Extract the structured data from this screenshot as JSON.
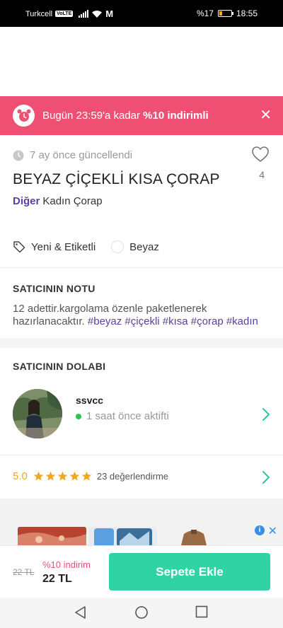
{
  "status_bar": {
    "carrier": "Turkcell",
    "volte": "VoLTE",
    "m_icon": "M",
    "battery_percent": "%17",
    "time": "18:55"
  },
  "promo": {
    "prefix": "Bugün 23:59'a kadar ",
    "highlight": "%10 indirimli",
    "icon": "alarm-clock-icon",
    "close": "✕"
  },
  "product": {
    "updated": "7 ay önce güncellendi",
    "like_count": "4",
    "title": "BEYAZ ÇİÇEKLİ KISA ÇORAP",
    "category_main": "Diğer",
    "category_sub": "Kadın Çorap",
    "condition": "Yeni & Etiketli",
    "color": "Beyaz",
    "color_hex": "#ffffff"
  },
  "seller_note": {
    "heading": "SATICININ NOTU",
    "text": "12 adettir.kargolama özenle paketlenerek hazırlanacaktır. ",
    "tags": "#beyaz #çiçekli #kısa #çorap #kadın"
  },
  "seller": {
    "heading": "SATICININ DOLABI",
    "username": "ssvcc",
    "status": "1 saat önce aktifti",
    "rating_score": "5.0",
    "rating_stars": 5,
    "rating_count": "23 değerlendirme"
  },
  "ad": {
    "choices": "i",
    "close": "✕"
  },
  "purchase": {
    "old_price": "22 TL",
    "discount_label": "%10 indirim",
    "new_price": "22 TL",
    "cart_button": "Sepete Ekle"
  },
  "colors": {
    "promo_bg": "#ef4f72",
    "accent_purple": "#5a3fa0",
    "cart_green": "#2fd3a4",
    "star_yellow": "#f0a81e",
    "chevron_teal": "#2fc4a0"
  }
}
